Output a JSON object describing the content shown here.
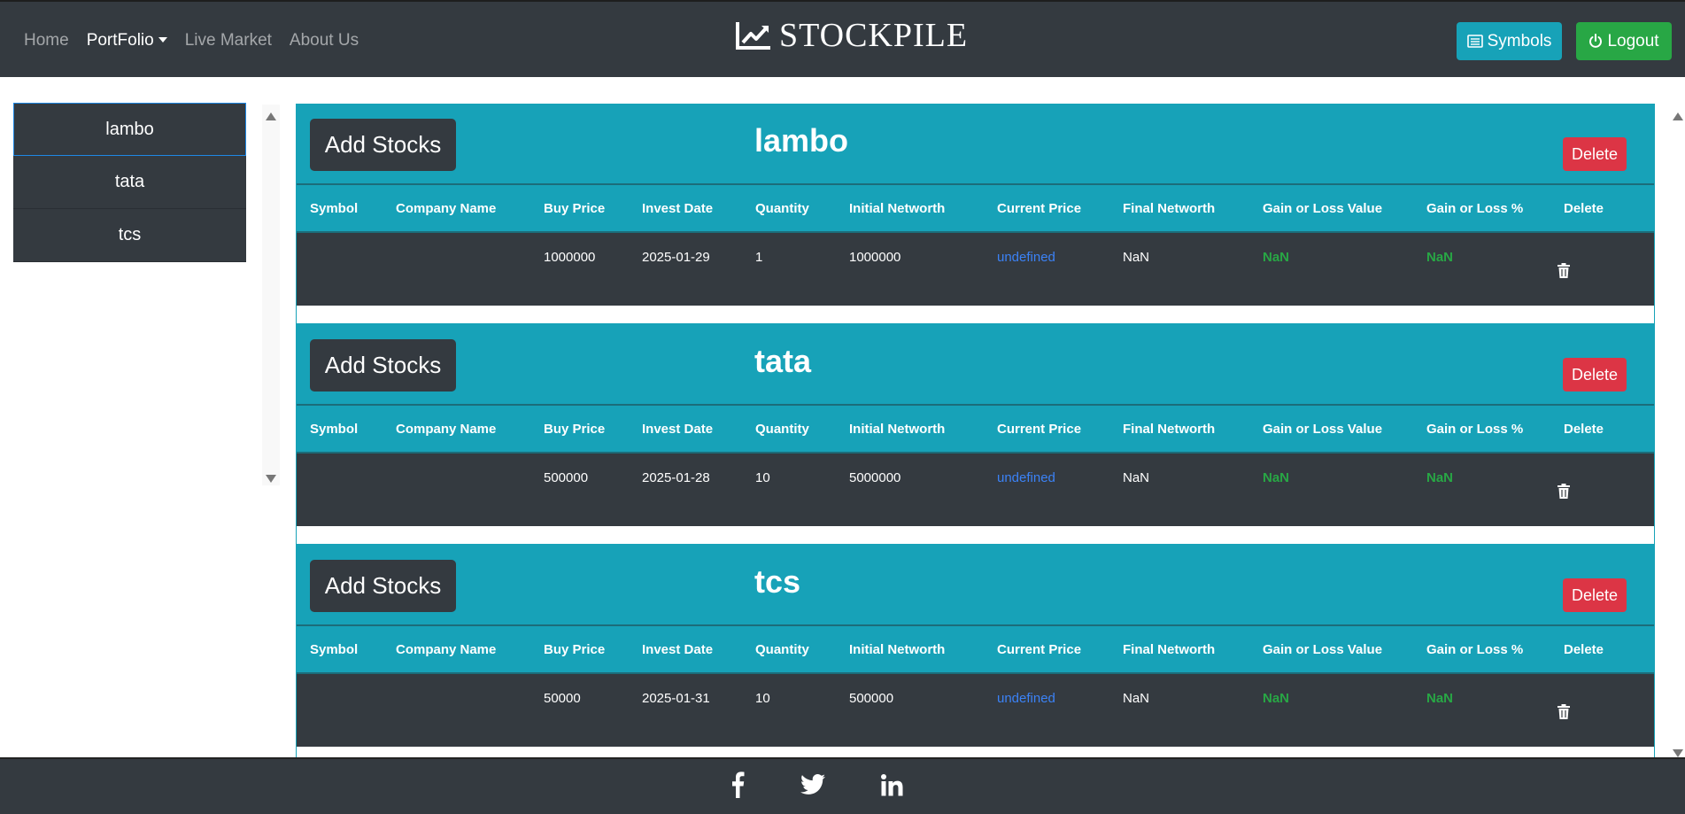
{
  "nav": {
    "links": [
      {
        "label": "Home"
      },
      {
        "label": "PortFolio"
      },
      {
        "label": "Live Market"
      },
      {
        "label": "About Us"
      }
    ],
    "brand": "STOCKPILE",
    "symbols_label": "Symbols",
    "logout_label": "Logout"
  },
  "sidebar": {
    "items": [
      {
        "label": "lambo"
      },
      {
        "label": "tata"
      },
      {
        "label": "tcs"
      }
    ]
  },
  "table_headers": [
    "Symbol",
    "Company Name",
    "Buy Price",
    "Invest Date",
    "Quantity",
    "Initial Networth",
    "Current Price",
    "Final Networth",
    "Gain or Loss Value",
    "Gain or Loss %",
    "Delete"
  ],
  "portfolios": [
    {
      "name": "lambo",
      "add_label": "Add Stocks",
      "delete_label": "Delete",
      "row": {
        "symbol": "",
        "company": "",
        "buy_price": "1000000",
        "invest_date": "2025-01-29",
        "quantity": "1",
        "initial_networth": "1000000",
        "current_price": "undefined",
        "final_networth": "NaN",
        "gain_loss_value": "NaN",
        "gain_loss_pct": "NaN"
      }
    },
    {
      "name": "tata",
      "add_label": "Add Stocks",
      "delete_label": "Delete",
      "row": {
        "symbol": "",
        "company": "",
        "buy_price": "500000",
        "invest_date": "2025-01-28",
        "quantity": "10",
        "initial_networth": "5000000",
        "current_price": "undefined",
        "final_networth": "NaN",
        "gain_loss_value": "NaN",
        "gain_loss_pct": "NaN"
      }
    },
    {
      "name": "tcs",
      "add_label": "Add Stocks",
      "delete_label": "Delete",
      "row": {
        "symbol": "",
        "company": "",
        "buy_price": "50000",
        "invest_date": "2025-01-31",
        "quantity": "10",
        "initial_networth": "500000",
        "current_price": "undefined",
        "final_networth": "NaN",
        "gain_loss_value": "NaN",
        "gain_loss_pct": "NaN"
      }
    }
  ],
  "colors": {
    "navbar": "#343a40",
    "card_accent": "#17a2b8",
    "danger": "#dc3545",
    "success": "#28a745",
    "link_blue": "#3b82f6"
  },
  "icons": {
    "brand": "chart-line-icon",
    "symbols": "list-icon",
    "logout": "power-icon",
    "row_delete": "trash-icon",
    "footer": [
      "facebook-icon",
      "twitter-icon",
      "linkedin-icon"
    ]
  }
}
